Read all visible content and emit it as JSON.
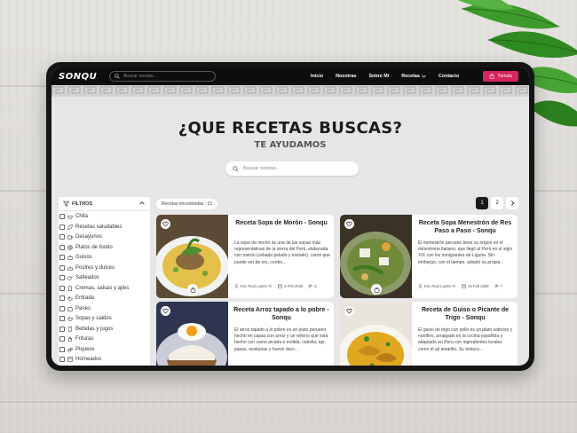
{
  "nav": {
    "logo": "SONQU",
    "search_placeholder": "Buscar recetas...",
    "links": [
      "Inicio",
      "Nosotras",
      "Sobre Mí",
      "Recetas"
    ],
    "contact": "Contacto",
    "shop": "Tienda"
  },
  "hero": {
    "title": "¿QUE RECETAS BUSCAS?",
    "subtitle": "TE AYUDAMOS",
    "search_placeholder": "Buscar recetas..."
  },
  "filters": {
    "header": "FILTROS",
    "categories": [
      "Chifa",
      "Recetas saludables",
      "Desayunos",
      "Platos de fondo",
      "Guisos",
      "Postres y dulces",
      "Salteados",
      "Cremas, salsas y ajíes",
      "Entrada",
      "Panes",
      "Sopas y caldos",
      "Bebidas y jugos",
      "Frituras",
      "Piqueos",
      "Horneados"
    ]
  },
  "results": {
    "count_label": "Recetas encontradas : 15",
    "pages": [
      "1",
      "2"
    ],
    "next": "›"
  },
  "cards": [
    {
      "title": "Receta Sopa de Morón - Sonqu",
      "desc": "La sopa de morón es una de las sopas más representativas de la sierra del Perú, elaborada con morón (cebada pelado y tostado), carne que puede ser de res, corder...",
      "author": "Eric Raul Layme R.",
      "date": "5 Feb 2025",
      "servings": "5"
    },
    {
      "title": "Receta Sopa Menestrón de Res Paso a Paso - Sonqu",
      "desc": "El menestrón peruano tiene su origen en el minestrone italiano, que llegó al Perú en el siglo XIX con los inmigrantes de Liguria. Sin embargo, con el tiempo, adoptó su propia...",
      "author": "Eric Raul Layme R.",
      "date": "15 Feb 2025",
      "servings": "7"
    },
    {
      "title": "Receta Arroz tapado a lo pobre - Sonqu",
      "desc": "El arroz tapado a lo pobre es un plato peruano hecho en capas con arroz y un relleno que está hecho con carne picada o molida, cebolla, ajo, pasas, aceitunas y huevo duro...",
      "author": "",
      "date": "",
      "servings": ""
    },
    {
      "title": "Receta de Guiso o Picante de Trigo - Sonqu",
      "desc": "El guiso de trigo con pollo es un plato sabroso y nutritivo, arraigado en la cocina española y adaptado en Perú con ingredientes locales como el ají amarillo. Su textura...",
      "author": "",
      "date": "",
      "servings": ""
    }
  ],
  "colors": {
    "accent": "#d6245d",
    "navbar": "#0d0d0d",
    "page_bg": "#e6e6e6"
  }
}
